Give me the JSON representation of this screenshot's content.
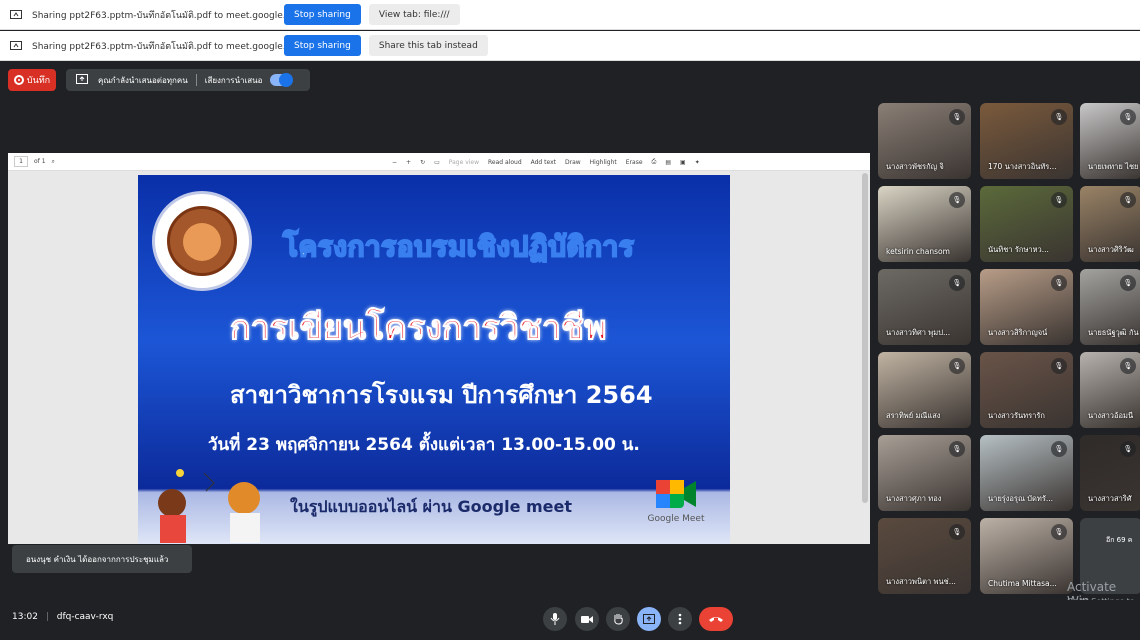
{
  "share_bars": [
    {
      "text": "Sharing ppt2F63.pptm-บันทึกอัตโนมัติ.pdf to meet.google.com",
      "primary": "Stop sharing",
      "secondary": "View tab: file:///"
    },
    {
      "text": "Sharing ppt2F63.pptm-บันทึกอัตโนมัติ.pdf to meet.google.com",
      "primary": "Stop sharing",
      "secondary": "Share this tab instead"
    }
  ],
  "top": {
    "record_label": "บันทึก",
    "presenting_label": "คุณกำลังนำเสนอต่อทุกคน",
    "audio_label": "เสียงการนำเสนอ"
  },
  "pdf_toolbar": {
    "page": "1",
    "of": "of 1",
    "page_view": "Page view",
    "read_aloud": "Read aloud",
    "add_text": "Add text",
    "draw": "Draw",
    "highlight": "Highlight",
    "erase": "Erase"
  },
  "slide": {
    "line1": "โครงการอบรมเชิงปฏิบัติการ",
    "line2": "การเขียนโครงการวิชาชีพ",
    "line3": "สาขาวิชาการโรงแรม ปีการศึกษา 2564",
    "line4": "วันที่ 23 พฤศจิกายน 2564 ตั้งแต่เวลา 13.00-15.00 น.",
    "line5": "ในรูปแบบออนไลน์ ผ่าน Google meet",
    "meet_logo": "Google Meet"
  },
  "toast": "อนงนุช คำเงิน ได้ออกจากการประชุมแล้ว",
  "participants": [
    {
      "name": "นางสาวพัชรกัญ จิ",
      "color": "#8a7f76"
    },
    {
      "name": "170 นางสาวอินทัร...",
      "color": "#7b5a3c"
    },
    {
      "name": "นายเพทาย ไชย",
      "color": "#c8c8c8"
    },
    {
      "name": "ketsirin chansom",
      "color": "#d9d4c4"
    },
    {
      "name": "นันทิชา รักษาหว...",
      "color": "#5b6a3a"
    },
    {
      "name": "นางสาวศิริวัฒ",
      "color": "#9a8366"
    },
    {
      "name": "นางสาวทิศา พุมป...",
      "color": "#6d6a64"
    },
    {
      "name": "นางสาวสิริกาญจน์",
      "color": "#b89d88"
    },
    {
      "name": "นายธนัฐวุฒิ กัน",
      "color": "#a3a39f"
    },
    {
      "name": "สราทิพย์ มณีแสง",
      "color": "#c1b4a3"
    },
    {
      "name": "นางสาวรันทรารัก",
      "color": "#6a5448"
    },
    {
      "name": "นางสาวอ้อมนี",
      "color": "#b7b2ad"
    },
    {
      "name": "นางสาวศุภา ทอง",
      "color": "#a89f96"
    },
    {
      "name": "นายรุ่งอรุณ บัดทรั...",
      "color": "#b6c0c4"
    },
    {
      "name": "นางสาวสาริศั",
      "color": "#2f2b29"
    },
    {
      "name": "นางสาวพนิตา พนช่...",
      "color": "#5a4a3e"
    },
    {
      "name": "Chutima Mittasa...",
      "color": "#bcb1a6"
    }
  ],
  "more_label": "อีก 69 ค",
  "bottom": {
    "time": "13:02",
    "code": "dfq-caav-rxq"
  },
  "watermark": {
    "line1": "Activate Win",
    "line2": "Go to Settings to"
  },
  "colors": {
    "stop_blue": "#1a73e8",
    "record_red": "#d93025",
    "end_call": "#ea4335",
    "bg": "#202124"
  }
}
